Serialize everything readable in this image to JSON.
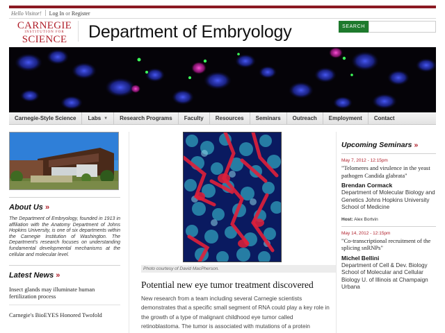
{
  "header": {
    "greeting": "Hello Visitor!",
    "login_label": "Log In",
    "or_label": "or",
    "register_label": "Register",
    "logo": {
      "line1": "CARNEGIE",
      "line2": "INSTITUTION FOR",
      "line3": "SCIENCE"
    },
    "site_title": "Department of Embryology",
    "search_button": "SEARCH",
    "search_placeholder": ""
  },
  "nav": {
    "items": [
      {
        "label": "Carnegie-Style Science"
      },
      {
        "label": "Labs",
        "has_dropdown": true
      },
      {
        "label": "Research Programs"
      },
      {
        "label": "Faculty"
      },
      {
        "label": "Resources"
      },
      {
        "label": "Seminars"
      },
      {
        "label": "Outreach"
      },
      {
        "label": "Employment"
      },
      {
        "label": "Contact"
      }
    ]
  },
  "left": {
    "about_title": "About Us",
    "about_text": "The Department of Embryology, founded in 1913 in affiliation with the Anatomy Department of Johns Hopkins University, is one of six departments within the Carnegie Institution of Washington. The Department's research focuses on understanding fundamental developmental mechanisms at the cellular and molecular level.",
    "news_title": "Latest News",
    "news": [
      {
        "title": "Insect glands may illuminate human fertilization process"
      },
      {
        "title": "Carnegie's BioEYES Honored Twofold"
      }
    ]
  },
  "center": {
    "caption": "Photo courtesy of David MacPherson.",
    "story_title": "Potential new eye tumor treatment discovered",
    "story_text": "New research from a team including several Carnegie scientists demonstrates that a specific small segment of RNA could play a key role in the growth of a type of malignant childhood eye tumor called retinoblastoma. The tumor is associated with mutations of a protein"
  },
  "right": {
    "seminars_title": "Upcoming Seminars",
    "seminars": [
      {
        "date": "May 7, 2012 - 12:15pm",
        "talk": "\"Telomeres and virulence in the yeast pathogen Candida glabrata\"",
        "speaker": "Brendan Cormack",
        "affiliation": "Department of Molecular Biology and Genetics Johns Hopkins University School of Medicine",
        "host_label": "Host:",
        "host": "Alex Bortvin"
      },
      {
        "date": "May 14, 2012 - 12:15pm",
        "talk": "\"Co-transcriptional recruitment of the splicing snRNPs\"",
        "speaker": "Michel Bellini",
        "affiliation": "Department of Cell & Dev. Biology School of Molecular and Cellular Biology U. of Illinois at Champaign Urbana"
      }
    ]
  },
  "colors": {
    "brand_red": "#b0202b",
    "top_bar": "#8b1a22",
    "search_green": "#1e7a2d"
  },
  "icons": {
    "raquo": "»",
    "dropdown": "chevron-down-icon"
  }
}
